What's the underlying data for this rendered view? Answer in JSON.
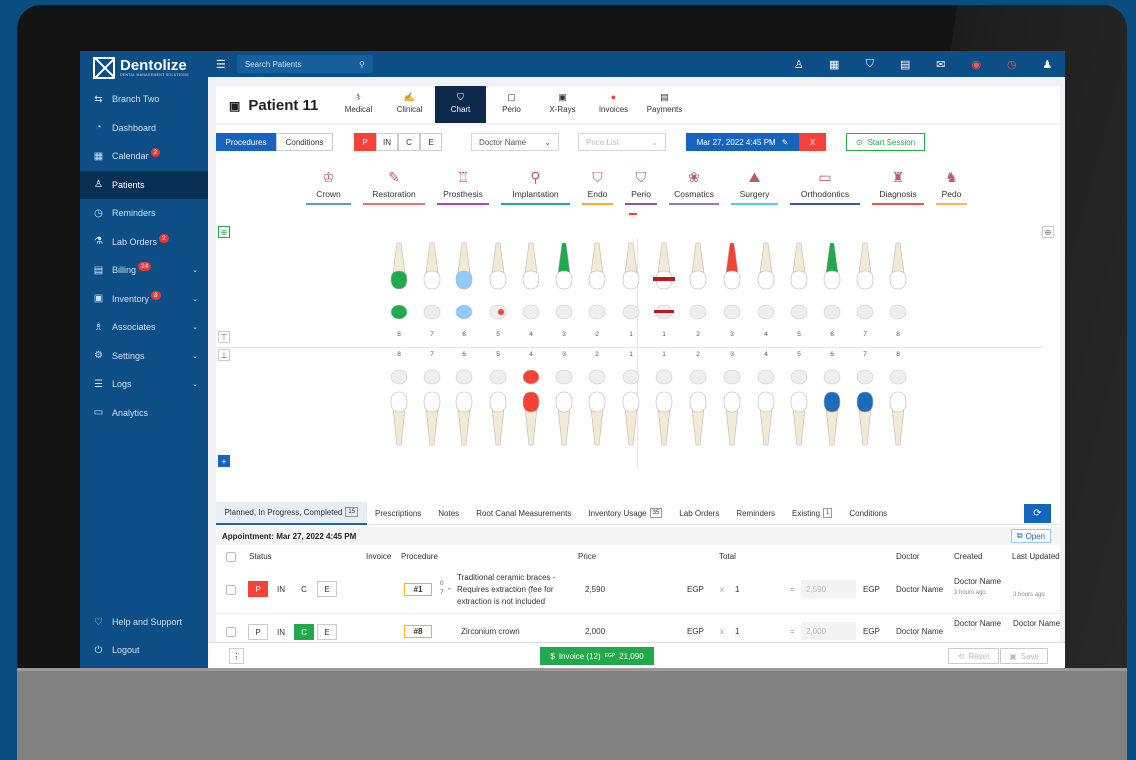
{
  "brand": {
    "name": "Dentolize",
    "tagline": "DENTAL MANAGEMENT SOLUTIONS"
  },
  "sidebar": {
    "items": [
      {
        "label": "Branch Two",
        "icon": "swap-icon"
      },
      {
        "label": "Dashboard",
        "icon": "dashboard-icon"
      },
      {
        "label": "Calendar",
        "icon": "calendar-icon",
        "badge": "2"
      },
      {
        "label": "Patients",
        "icon": "patients-icon",
        "active": true
      },
      {
        "label": "Reminders",
        "icon": "reminder-icon"
      },
      {
        "label": "Lab Orders",
        "icon": "lab-icon",
        "badge": "2"
      },
      {
        "label": "Billing",
        "icon": "billing-icon",
        "badge": "24",
        "chevron": true
      },
      {
        "label": "Inventory",
        "icon": "inventory-icon",
        "badge": "8",
        "chevron": true
      },
      {
        "label": "Associates",
        "icon": "associates-icon",
        "chevron": true
      },
      {
        "label": "Settings",
        "icon": "settings-icon",
        "chevron": true
      },
      {
        "label": "Logs",
        "icon": "logs-icon",
        "chevron": true
      },
      {
        "label": "Analytics",
        "icon": "analytics-icon"
      }
    ],
    "help": "Help and Support",
    "logout": "Logout"
  },
  "topbar": {
    "search_placeholder": "Search Patients"
  },
  "patient": {
    "name": "Patient 11"
  },
  "patient_tabs": [
    "Medical",
    "Clinical",
    "Chart",
    "Perio",
    "X-Rays",
    "Invoices",
    "Payments"
  ],
  "controls": {
    "procedures": "Procedures",
    "conditions": "Conditions",
    "status": [
      "P",
      "IN",
      "C",
      "E"
    ],
    "doctor": "Doctor Name",
    "price_list": "Price List",
    "date": "Mar 27, 2022 4:45 PM",
    "close": "X",
    "start": "Start Session"
  },
  "categories": [
    {
      "label": "Crown",
      "color": "#5b9bd5"
    },
    {
      "label": "Restoration",
      "color": "#e57373"
    },
    {
      "label": "Prosthesis",
      "color": "#ab47bc"
    },
    {
      "label": "Implantation",
      "color": "#26a69a"
    },
    {
      "label": "Endo",
      "color": "#ffa726"
    },
    {
      "label": "Perio",
      "color": "#7e57c2"
    },
    {
      "label": "Cosmatics",
      "color": "#9575cd"
    },
    {
      "label": "Surgery",
      "color": "#4dd0e1"
    },
    {
      "label": "Orthodontics",
      "color": "#3f51b5"
    },
    {
      "label": "Diagnosis",
      "color": "#ef5350"
    },
    {
      "label": "Pedo",
      "color": "#ffb74d"
    }
  ],
  "tooth_numbers": [
    "8",
    "7",
    "6",
    "5",
    "4",
    "3",
    "2",
    "1",
    "1",
    "2",
    "3",
    "4",
    "5",
    "6",
    "7",
    "8"
  ],
  "bottom_tabs": [
    {
      "label": "Planned, In Progress, Completed",
      "count": "15"
    },
    {
      "label": "Prescriptions"
    },
    {
      "label": "Notes"
    },
    {
      "label": "Root Canal Measurements"
    },
    {
      "label": "Inventory Usage",
      "count": "35"
    },
    {
      "label": "Lab Orders"
    },
    {
      "label": "Reminders"
    },
    {
      "label": "Existing",
      "count": "1"
    },
    {
      "label": "Conditions"
    }
  ],
  "appointment": {
    "label": "Appointment: Mar 27, 2022 4:45 PM",
    "open": "Open"
  },
  "table": {
    "headers": {
      "status": "Status",
      "invoice": "Invoice",
      "procedure": "Procedure",
      "price": "Price",
      "total": "Total",
      "doctor": "Doctor",
      "created": "Created",
      "updated": "Last Updated"
    },
    "rows": [
      {
        "num": "#1",
        "tooth_top": "0",
        "tooth_bottom": "7",
        "procedure": "Traditional ceramic braces - Requires extraction (fee for extraction is not included",
        "price": "2,590",
        "currency": "EGP",
        "qty": "1",
        "total": "2,590",
        "doctor": "Doctor Name",
        "created_doctor": "Doctor Name",
        "created_time": "3 hours ago",
        "updated_time": "3 hours ago"
      },
      {
        "num": "#8",
        "procedure": "Zirconium crown",
        "price": "2,000",
        "currency": "EGP",
        "qty": "1",
        "total": "2,000",
        "doctor": "Doctor Name",
        "created_doctor": "Doctor Name",
        "updated_doctor": "Doctor Name"
      }
    ]
  },
  "footer": {
    "invoice": "Invoice (12)",
    "currency": "EGP",
    "amount": "21,090",
    "reset": "Reset",
    "save": "Save"
  }
}
